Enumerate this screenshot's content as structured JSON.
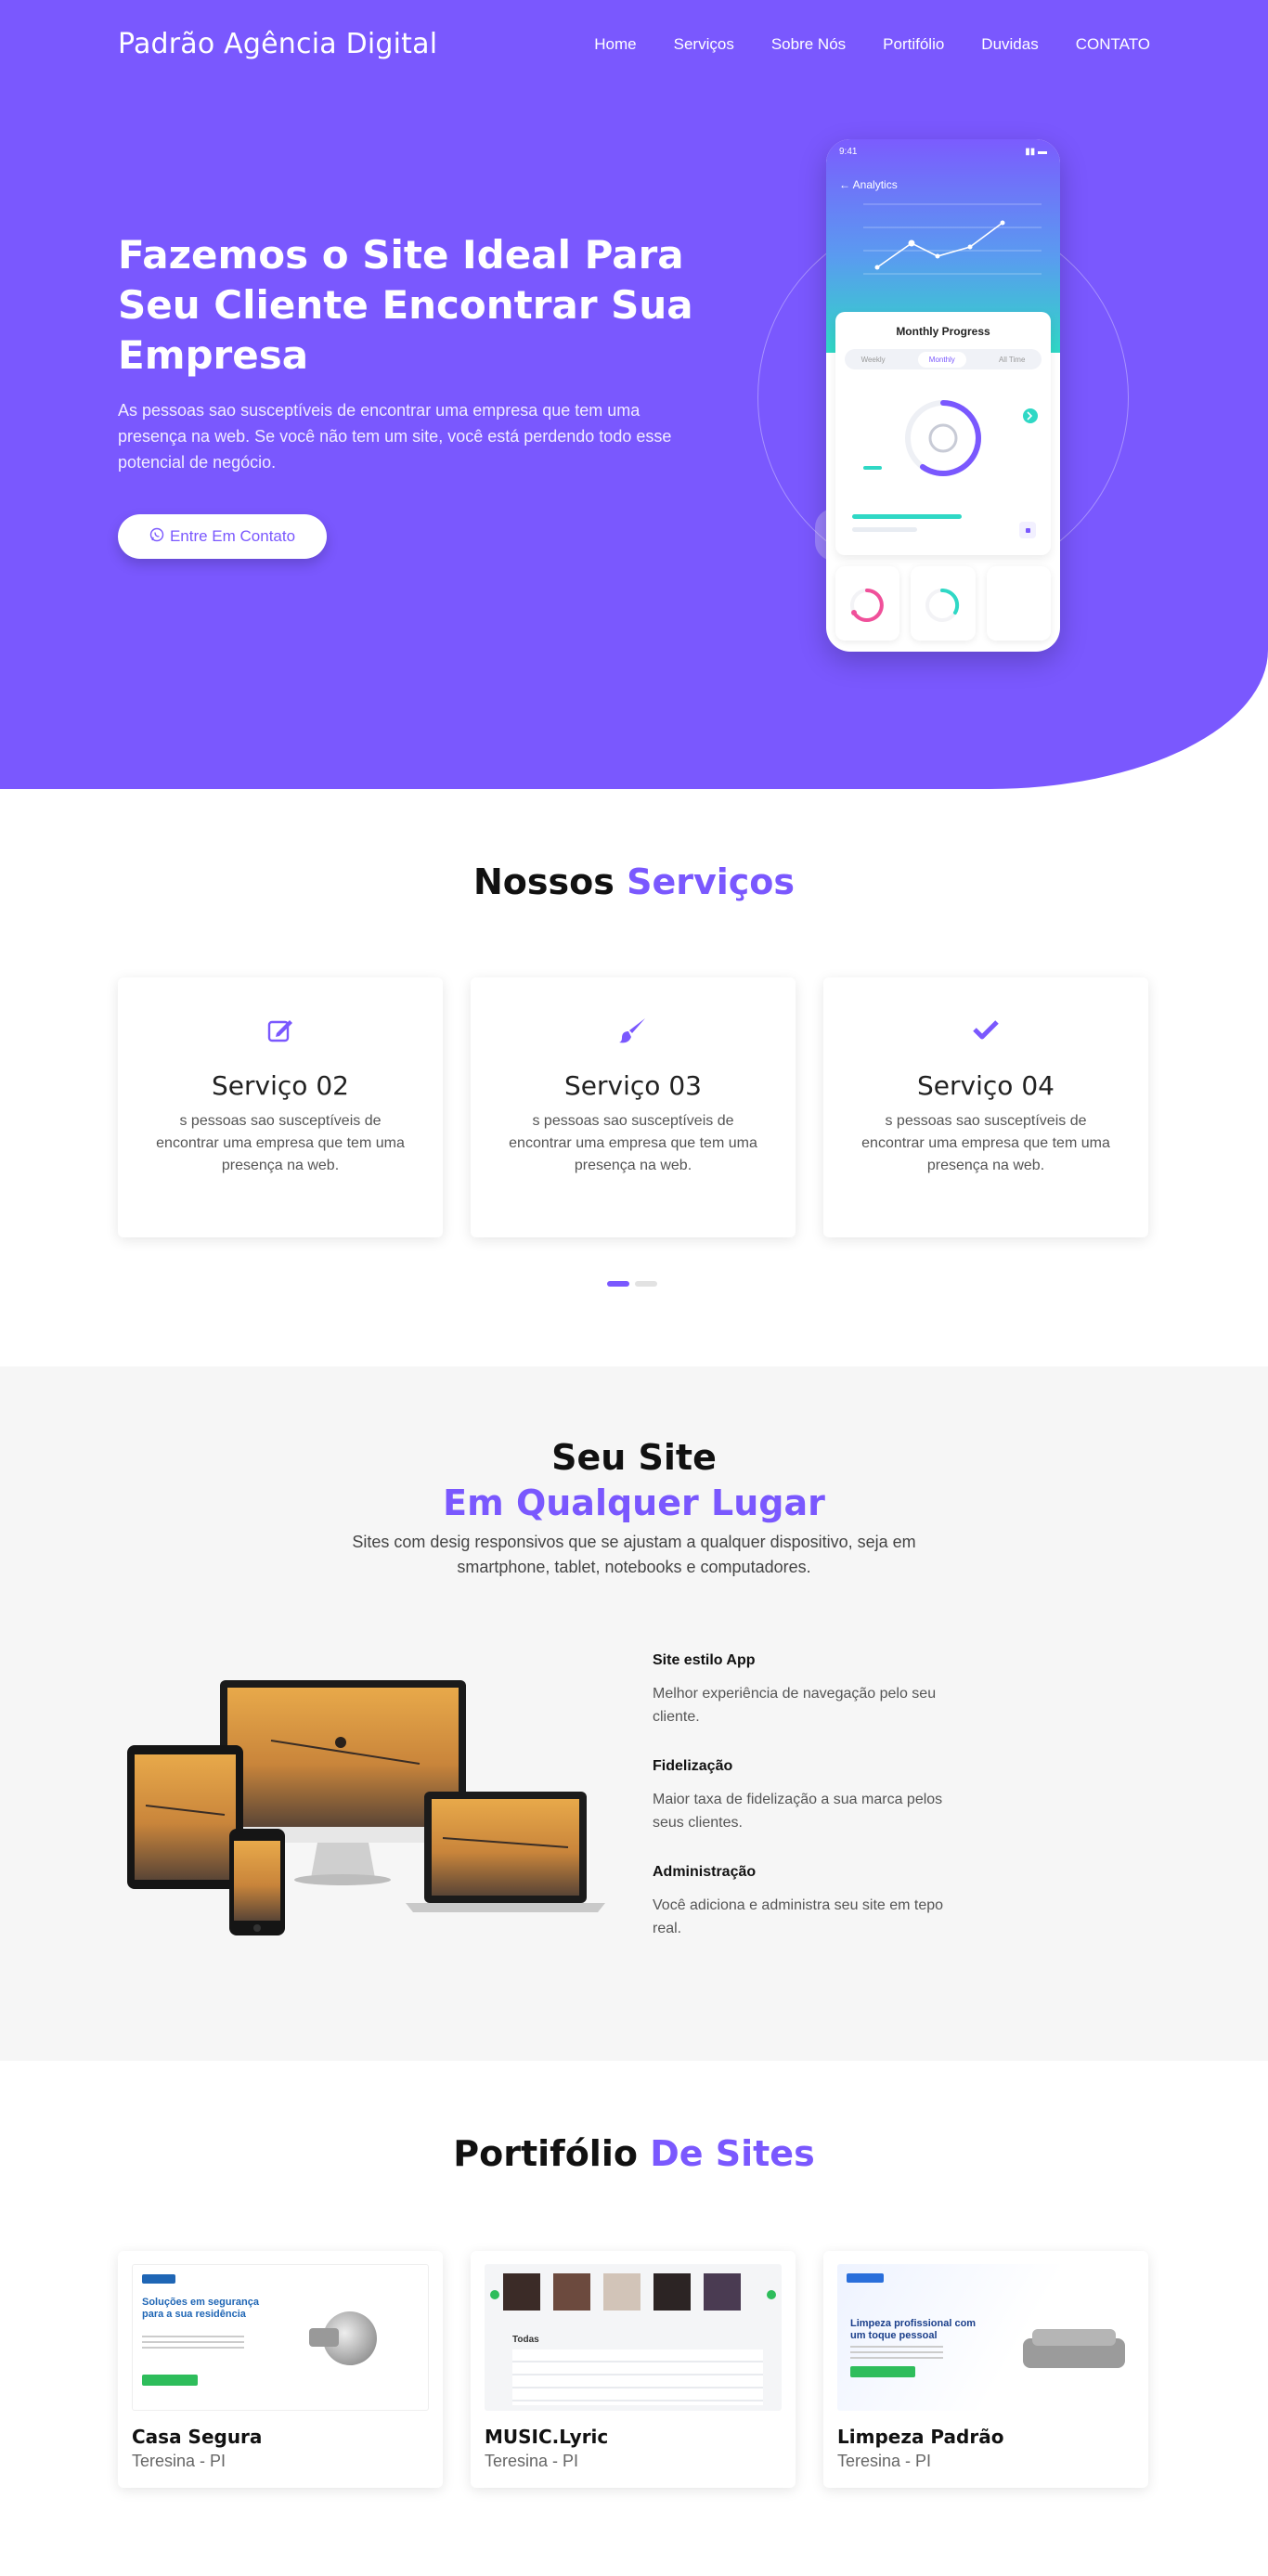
{
  "nav": {
    "brand": "Padrão Agência Digital",
    "items": [
      "Home",
      "Serviços",
      "Sobre Nós",
      "Portifólio",
      "Duvidas",
      "CONTATO"
    ]
  },
  "hero": {
    "title": "Fazemos o Site Ideal Para Seu Cliente Encontrar Sua Empresa",
    "text": "As pessoas sao susceptíveis de encontrar uma empresa que tem uma presença na web. Se você não tem um site, você está perdendo todo esse potencial de negócio.",
    "cta": "Entre Em Contato",
    "phone": {
      "time": "9:41",
      "title": "Analytics",
      "card_title": "Monthly Progress",
      "tabs": [
        "Weekly",
        "Monthly",
        "All Time"
      ]
    }
  },
  "services": {
    "title_main": "Nossos",
    "title_accent": "Serviços",
    "cards": [
      {
        "title": "Serviço 02",
        "text": "s pessoas sao susceptíveis de encontrar uma empresa que tem uma presença na web.",
        "icon": "edit-icon"
      },
      {
        "title": "Serviço 03",
        "text": "s pessoas sao susceptíveis de encontrar uma empresa que tem uma presença na web.",
        "icon": "brush-icon"
      },
      {
        "title": "Serviço 04",
        "text": "s pessoas sao susceptíveis de encontrar uma empresa que tem uma presença na web.",
        "icon": "check-icon"
      }
    ]
  },
  "responsive": {
    "title": "Seu Site",
    "title_accent": "Em Qualquer Lugar",
    "subtitle": "Sites com desig responsivos que se ajustam a qualquer dispositivo, seja em smartphone, tablet, notebooks e computadores.",
    "features": [
      {
        "title": "Site estilo App",
        "text": "Melhor experiência de navegação pelo seu cliente."
      },
      {
        "title": "Fidelização",
        "text": "Maior taxa de fidelização a sua marca pelos seus clientes."
      },
      {
        "title": "Administração",
        "text": "Você adiciona e administra seu site em tepo real."
      }
    ]
  },
  "portfolio": {
    "title_main": "Portifólio",
    "title_accent": "De Sites",
    "items": [
      {
        "name": "Casa Segura",
        "location": "Teresina - PI",
        "thumb_headline": "Soluções em segurança para a sua residência"
      },
      {
        "name": "MUSIC.Lyric",
        "location": "Teresina - PI",
        "thumb_headline": "Todas"
      },
      {
        "name": "Limpeza Padrão",
        "location": "Teresina - PI",
        "thumb_headline": "Limpeza profissional com um toque pessoal"
      }
    ]
  },
  "colors": {
    "accent": "#7a58fe",
    "teal": "#2fd8c5",
    "pink": "#f0509a"
  }
}
